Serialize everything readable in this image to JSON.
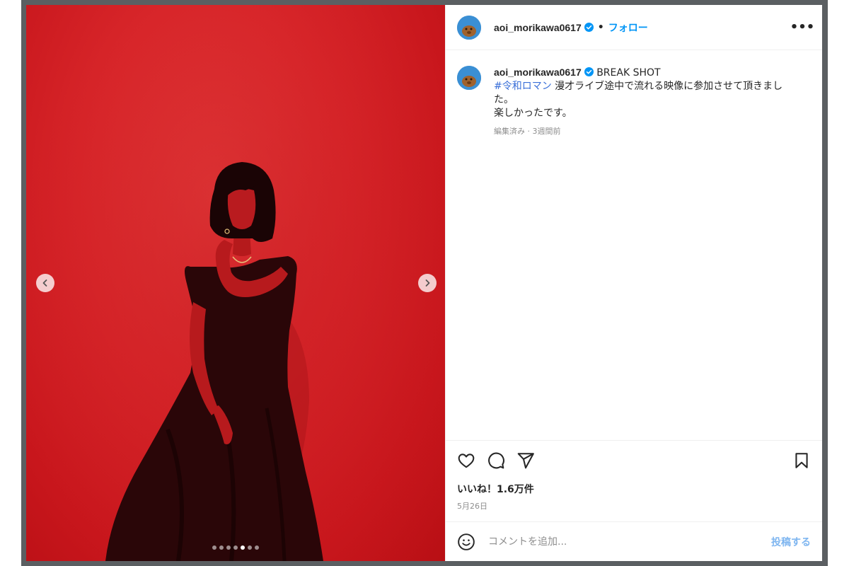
{
  "post": {
    "username": "aoi_morikawa0617",
    "separator": "•",
    "follow_label": "フォロー",
    "more_label": "•••"
  },
  "caption": {
    "username": "aoi_morikawa0617",
    "title": "BREAK SHOT",
    "hashtag": "#令和ロマン",
    "text_line1": " 漫才ライブ途中で流れる映像に参加させて頂きまし",
    "text_line2": "た。",
    "text_line3": "楽しかったです。",
    "meta": "編集済み · 3週間前"
  },
  "carousel": {
    "total": 7,
    "active_index": 4
  },
  "icons": {
    "like": "heart-icon",
    "comment": "comment-bubble-icon",
    "share": "paper-plane-icon",
    "save": "bookmark-icon",
    "emoji": "smiley-icon",
    "verified": "verified-badge-icon",
    "prev": "chevron-left-icon",
    "next": "chevron-right-icon"
  },
  "stats": {
    "likes": "いいね！1.6万件",
    "date": "5月26日"
  },
  "comment_box": {
    "placeholder": "コメントを追加...",
    "post_label": "投稿する"
  },
  "colors": {
    "accent": "#0095f6",
    "photo_bg": "#d8262a",
    "post_button_disabled": "#7fb6f0"
  }
}
